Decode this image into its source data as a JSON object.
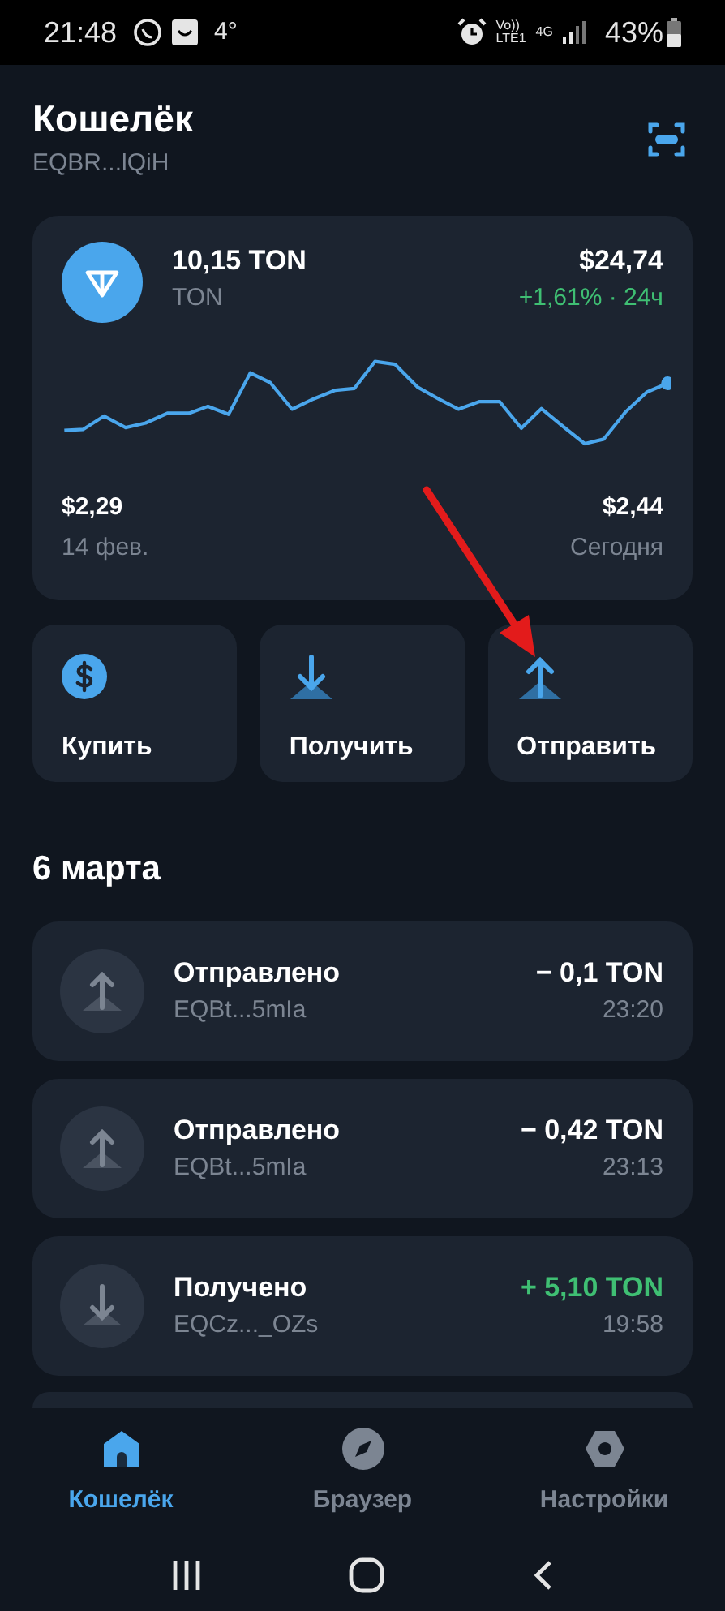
{
  "status_bar": {
    "time": "21:48",
    "temperature": "4°",
    "volte": "Vo))",
    "lte": "LTE1",
    "network": "4G",
    "battery": "43%"
  },
  "header": {
    "title": "Кошелёк",
    "address": "EQBR...lQiH"
  },
  "balance_card": {
    "amount": "10,15 TON",
    "token": "TON",
    "fiat": "$24,74",
    "change": "+1,61% · 24ч",
    "low_price": "$2,29",
    "low_date": "14 фев.",
    "current_price": "$2,44",
    "current_label": "Сегодня"
  },
  "actions": [
    {
      "kind": "buy",
      "label": "Купить"
    },
    {
      "kind": "receive",
      "label": "Получить"
    },
    {
      "kind": "send",
      "label": "Отправить"
    }
  ],
  "date_heading": "6 марта",
  "transactions": [
    {
      "kind": "sent",
      "title": "Отправлено",
      "address": "EQBt...5mIa",
      "amount": "− 0,1 TON",
      "time": "23:20"
    },
    {
      "kind": "sent",
      "title": "Отправлено",
      "address": "EQBt...5mIa",
      "amount": "− 0,42 TON",
      "time": "23:13"
    },
    {
      "kind": "received",
      "title": "Получено",
      "address": "EQCz..._OZs",
      "amount": "+ 5,10 TON",
      "time": "19:58"
    }
  ],
  "tabs": [
    {
      "kind": "wallet",
      "label": "Кошелёк",
      "selected": true
    },
    {
      "kind": "browser",
      "label": "Браузер",
      "selected": false
    },
    {
      "kind": "settings",
      "label": "Настройки",
      "selected": false
    }
  ]
}
